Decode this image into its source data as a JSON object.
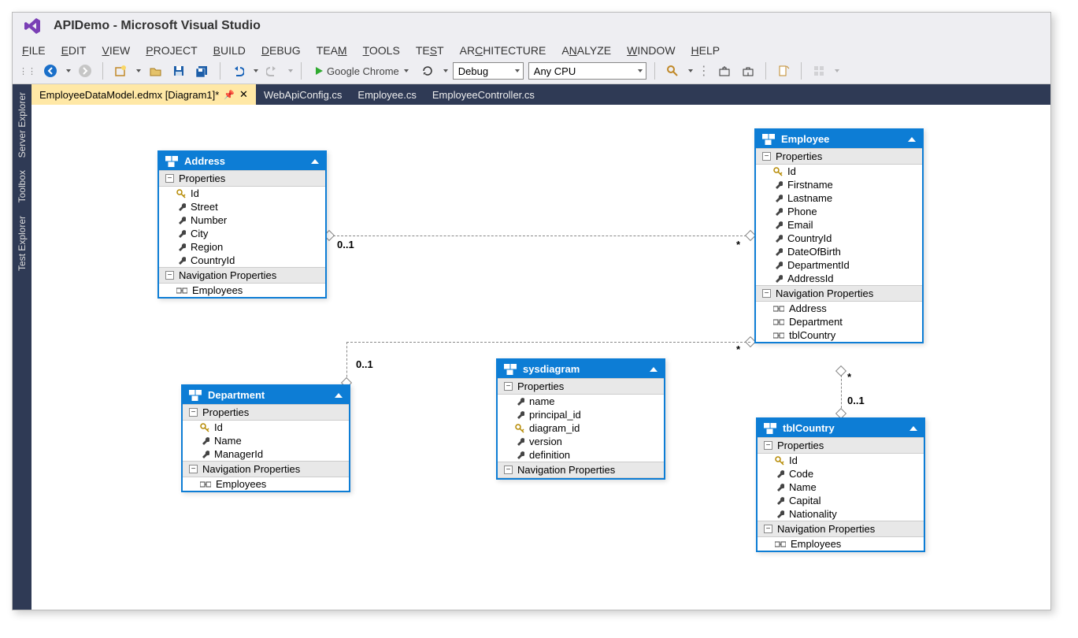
{
  "app": {
    "title": "APIDemo - Microsoft Visual Studio"
  },
  "menu": {
    "file": "FILE",
    "edit": "EDIT",
    "view": "VIEW",
    "project": "PROJECT",
    "build": "BUILD",
    "debug": "DEBUG",
    "team": "TEAM",
    "tools": "TOOLS",
    "test": "TEST",
    "architecture": "ARCHITECTURE",
    "analyze": "ANALYZE",
    "window": "WINDOW",
    "help": "HELP"
  },
  "toolbar": {
    "browser": "Google Chrome",
    "config": "Debug",
    "platform": "Any CPU"
  },
  "sidetabs": {
    "server": "Server Explorer",
    "toolbox": "Toolbox",
    "test": "Test Explorer"
  },
  "tabs": {
    "active": "EmployeeDataModel.edmx [Diagram1]*",
    "t1": "WebApiConfig.cs",
    "t2": "Employee.cs",
    "t3": "EmployeeController.cs"
  },
  "labels": {
    "properties": "Properties",
    "navprops": "Navigation Properties"
  },
  "entities": {
    "address": {
      "title": "Address",
      "props": [
        "Id",
        "Street",
        "Number",
        "City",
        "Region",
        "CountryId"
      ],
      "nav": [
        "Employees"
      ]
    },
    "employee": {
      "title": "Employee",
      "props": [
        "Id",
        "Firstname",
        "Lastname",
        "Phone",
        "Email",
        "CountryId",
        "DateOfBirth",
        "DepartmentId",
        "AddressId"
      ],
      "nav": [
        "Address",
        "Department",
        "tblCountry"
      ]
    },
    "department": {
      "title": "Department",
      "props": [
        "Id",
        "Name",
        "ManagerId"
      ],
      "nav": [
        "Employees"
      ]
    },
    "sysdiagram": {
      "title": "sysdiagram",
      "props": [
        "name",
        "principal_id",
        "diagram_id",
        "version",
        "definition"
      ],
      "nav": []
    },
    "tblcountry": {
      "title": "tblCountry",
      "props": [
        "Id",
        "Code",
        "Name",
        "Capital",
        "Nationality"
      ],
      "nav": [
        "Employees"
      ]
    }
  },
  "relations": {
    "addr_emp_left": "0..1",
    "addr_emp_right": "*",
    "dept_emp_left": "0..1",
    "dept_emp_right": "*",
    "country_emp_top": "*",
    "country_emp_bottom": "0..1"
  }
}
